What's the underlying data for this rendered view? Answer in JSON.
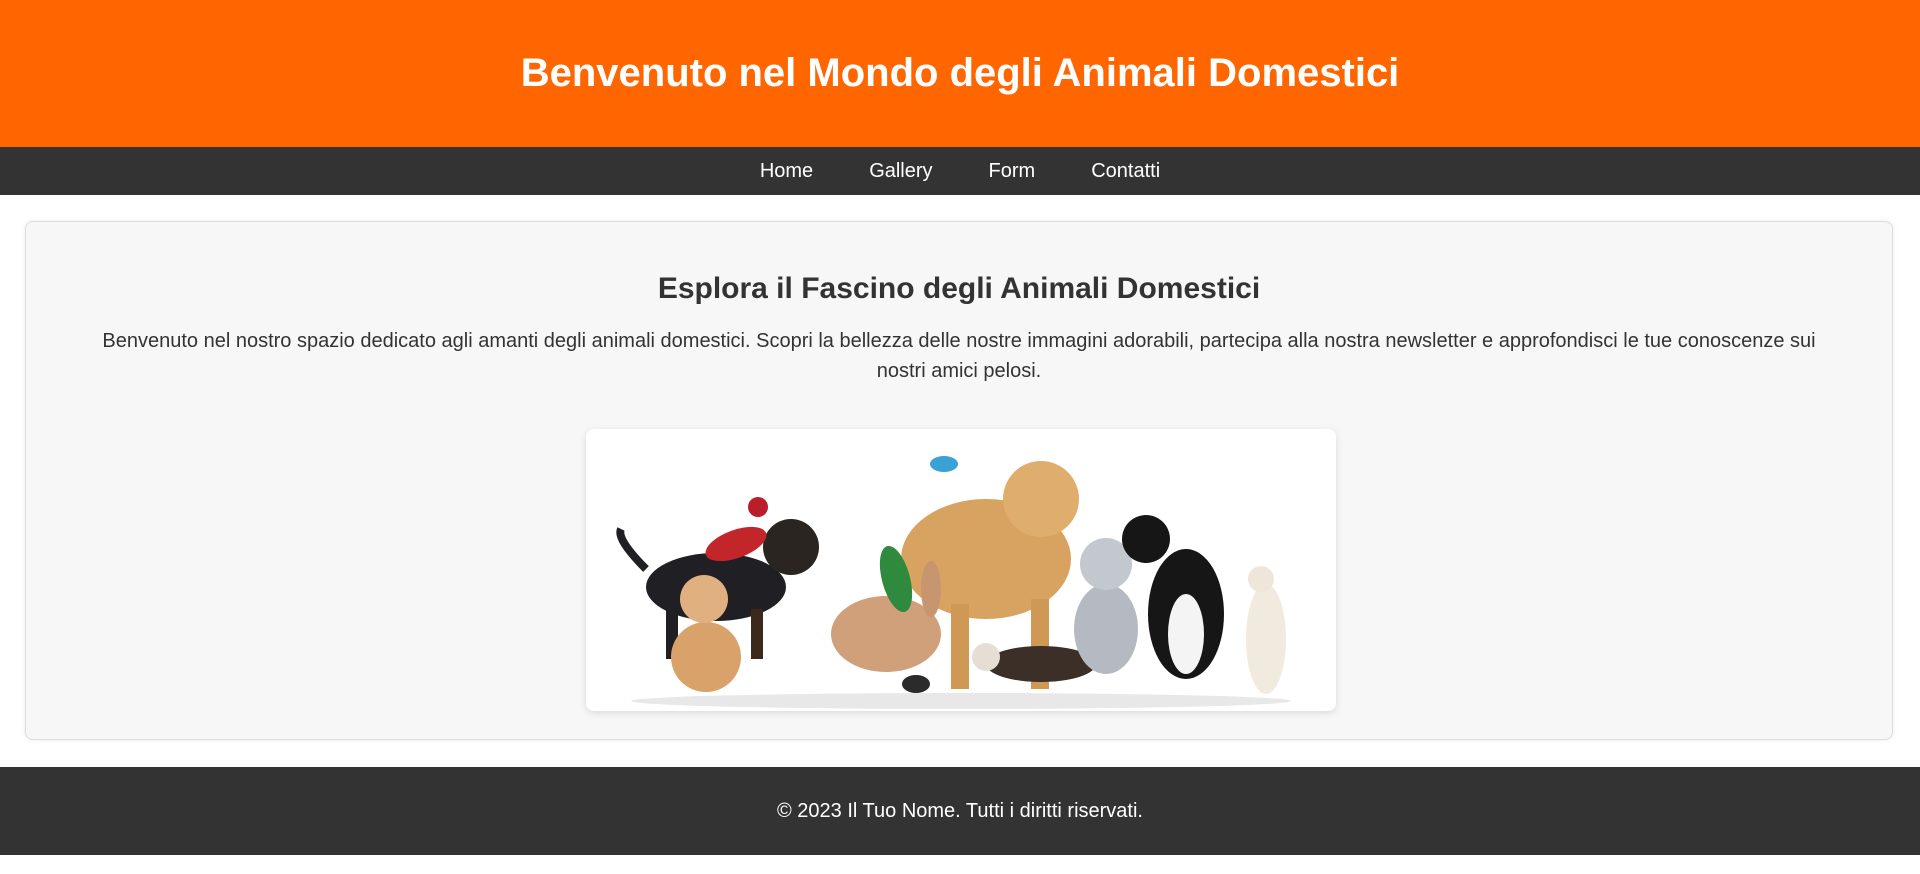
{
  "header": {
    "title": "Benvenuto nel Mondo degli Animali Domestici"
  },
  "nav": {
    "items": [
      {
        "label": "Home"
      },
      {
        "label": "Gallery"
      },
      {
        "label": "Form"
      },
      {
        "label": "Contatti"
      }
    ]
  },
  "main": {
    "heading": "Esplora il Fascino degli Animali Domestici",
    "intro": "Benvenuto nel nostro spazio dedicato agli amanti degli animali domestici. Scopri la bellezza delle nostre immagini adorabili, partecipa alla nostra newsletter e approfondisci le tue conoscenze sui nostri amici pelosi."
  },
  "footer": {
    "copyright": "© 2023 Il Tuo Nome. Tutti i diritti riservati."
  },
  "colors": {
    "header_bg": "#ff6600",
    "nav_bg": "#333333",
    "footer_bg": "#333333",
    "card_bg": "#f7f7f7"
  }
}
